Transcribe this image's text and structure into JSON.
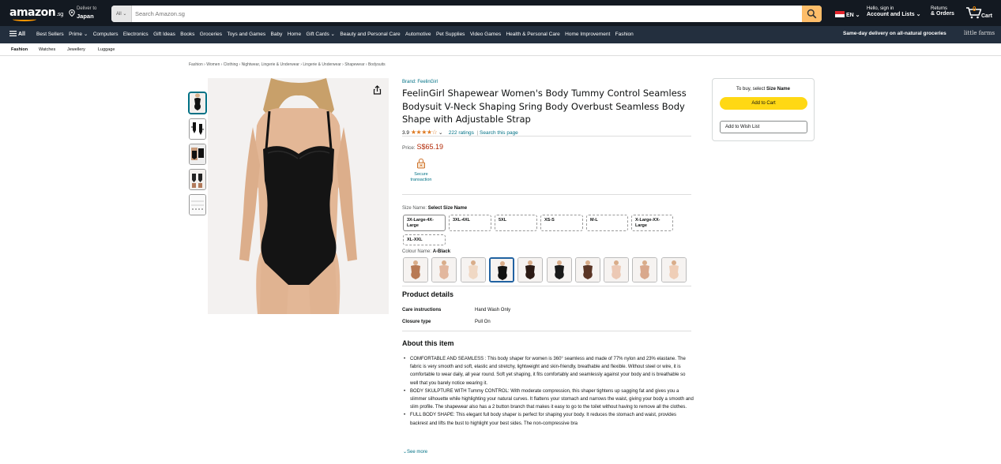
{
  "header": {
    "logo_text": "amazon",
    "logo_suffix": ".sg",
    "deliver_line1": "Deliver to",
    "deliver_line2": "Japan",
    "search_category": "All ⌄",
    "search_placeholder": "Search Amazon.sg",
    "language": "EN ⌄",
    "account_line1": "Hello, sign in",
    "account_line2": "Account and Lists ⌄",
    "orders_line1": "Returns",
    "orders_line2": "& Orders",
    "cart_count": "0",
    "cart_label": "Cart"
  },
  "main_nav": {
    "all_label": "All",
    "links": [
      "Best Sellers",
      "Prime ⌄",
      "Computers",
      "Electronics",
      "Gift Ideas",
      "Books",
      "Groceries",
      "Toys and Games",
      "Baby",
      "Home",
      "Gift Cards ⌄",
      "Beauty and Personal Care",
      "Automotive",
      "Pet Supplies",
      "Video Games",
      "Health & Personal Care",
      "Home Improvement",
      "Fashion"
    ],
    "promo": "Same-day delivery on all-natural groceries",
    "promo_brand": "little farms"
  },
  "sub_nav": [
    "Fashion",
    "Watches",
    "Jewellery",
    "Luggage"
  ],
  "breadcrumb": "Fashion › Women › Clothing › Nightwear, Lingerie & Underwear › Lingerie & Underwear › Shapewear › Bodysuits",
  "product": {
    "brand": "Brand: FeelinGirl",
    "title": "FeelinGirl Shapewear Women's Body Tummy Control Seamless Bodysuit V-Neck Shaping Sring Body Overbust Seamless Body Shape with Adjustable Strap",
    "rating_value": "3.9",
    "stars": "★★★★☆",
    "ratings_count": "222 ratings",
    "search_page": "Search this page",
    "price_label": "Price:",
    "price": "S$65.19",
    "secure_line1": "Secure",
    "secure_line2": "transaction",
    "size_label": "Size Name:",
    "size_selected": "Select Size Name",
    "sizes": [
      "3X-Large-4X-Large",
      "3XL-4XL",
      "5XL",
      "XS-S",
      "M-L",
      "X-Large-XX-Large",
      "XL-XXL"
    ],
    "colour_label": "Colour Name:",
    "colour_selected": "A-Black",
    "swatch_colors": [
      "#b87a55",
      "#e2b79e",
      "#f0d8c4",
      "#111111",
      "#2b1a14",
      "#1a1a1a",
      "#5a3525",
      "#ecc9b5",
      "#d9a88c",
      "#efceb7"
    ],
    "details_heading": "Product details",
    "details": [
      {
        "key": "Care instructions",
        "value": "Hand Wash Only"
      },
      {
        "key": "Closure type",
        "value": "Pull On"
      }
    ],
    "about_heading": "About this item",
    "bullets": [
      "COMFORTABLE AND SEAMLESS : This body shaper for women is 360° seamless and made of 77% nylon and 23% elastane. The fabric is very smooth and soft, elastic and stretchy, lightweight and skin-friendly, breathable and flexible. Without steel or wire, it is comfortable to wear daily, all year round. Soft yet shaping, it fits comfortably and seamlessly against your body and is breathable so well that you barely notice wearing it.",
      "BODY SKULPTURE WITH Tummy CONTROL: With moderate compression, this shaper tightens up sagging fat and gives you a slimmer silhouette while highlighting your natural curves. It flattens your stomach and narrows the waist, giving your body a smooth and slim profile. The shapewear also has a 2 button branch that makes it easy to go to the toilet without having to remove all the clothes.",
      "FULL BODY SHAPE: This elegant full body shaper is perfect for shaping your body. It reduces the stomach and waist, provides backrest and lifts the bust to highlight your best sides. The non-compressive bra"
    ],
    "see_more": "See more"
  },
  "buybox": {
    "message_prefix": "To buy, select",
    "message_bold": "Size Name",
    "add_to_cart": "Add to Cart",
    "add_to_wish_list": "Add to Wish List"
  },
  "colors": {
    "nav_dark": "#131921",
    "nav_secondary": "#232f3e",
    "accent": "#ff9900",
    "link": "#007185",
    "price": "#b12704",
    "cart_button": "#ffd814",
    "star": "#de7921"
  }
}
